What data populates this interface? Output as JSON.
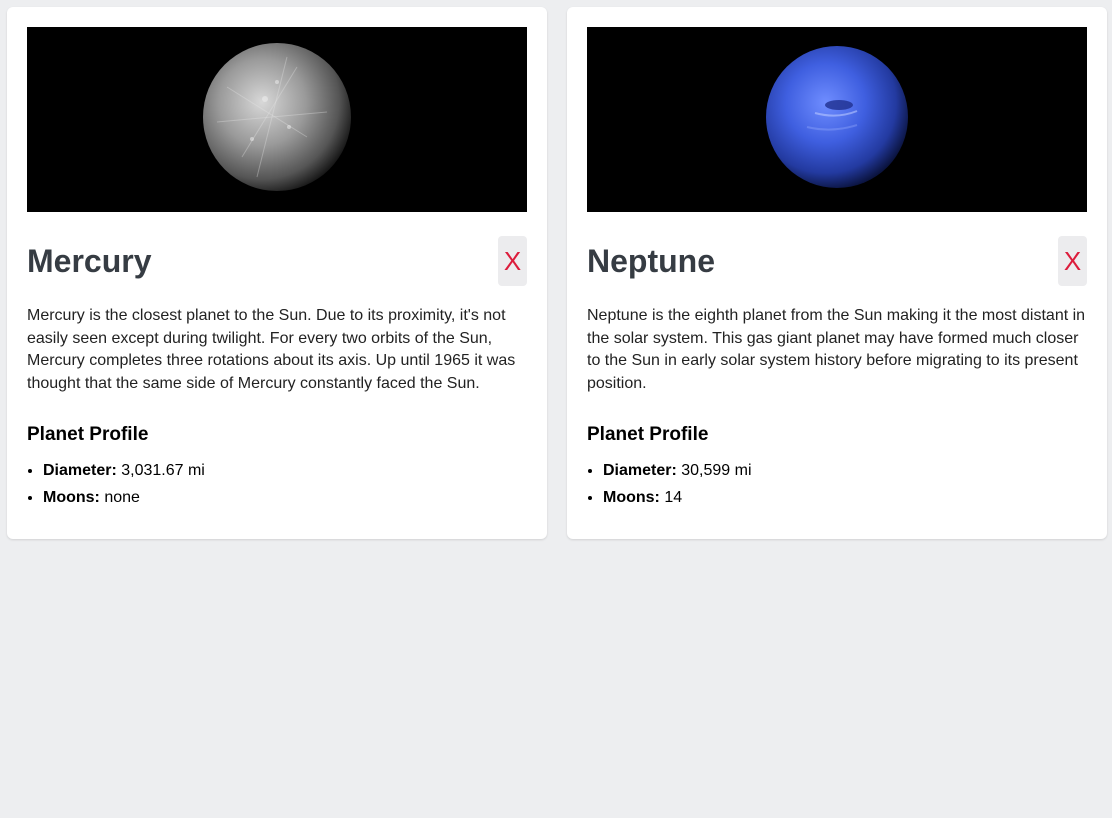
{
  "planets": [
    {
      "name": "Mercury",
      "close_label": "X",
      "description": "Mercury is the closest planet to the Sun. Due to its proximity, it's not easily seen except during twilight. For every two orbits of the Sun, Mercury completes three rotations about its axis. Up until 1965 it was thought that the same side of Mercury constantly faced the Sun.",
      "profile_heading": "Planet Profile",
      "stats": [
        {
          "label": "Diameter:",
          "value": "3,031.67 mi"
        },
        {
          "label": "Moons:",
          "value": "none"
        }
      ],
      "image_icon": "mercury-planet-image"
    },
    {
      "name": "Neptune",
      "close_label": "X",
      "description": "Neptune is the eighth planet from the Sun making it the most distant in the solar system. This gas giant planet may have formed much closer to the Sun in early solar system history before migrating to its present position.",
      "profile_heading": "Planet Profile",
      "stats": [
        {
          "label": "Diameter:",
          "value": "30,599 mi"
        },
        {
          "label": "Moons:",
          "value": "14"
        }
      ],
      "image_icon": "neptune-planet-image"
    }
  ],
  "colors": {
    "page_background": "#edeef0",
    "card_background": "#ffffff",
    "title": "#363c43",
    "close_text": "#dc1d3c",
    "close_background": "#ececee"
  }
}
